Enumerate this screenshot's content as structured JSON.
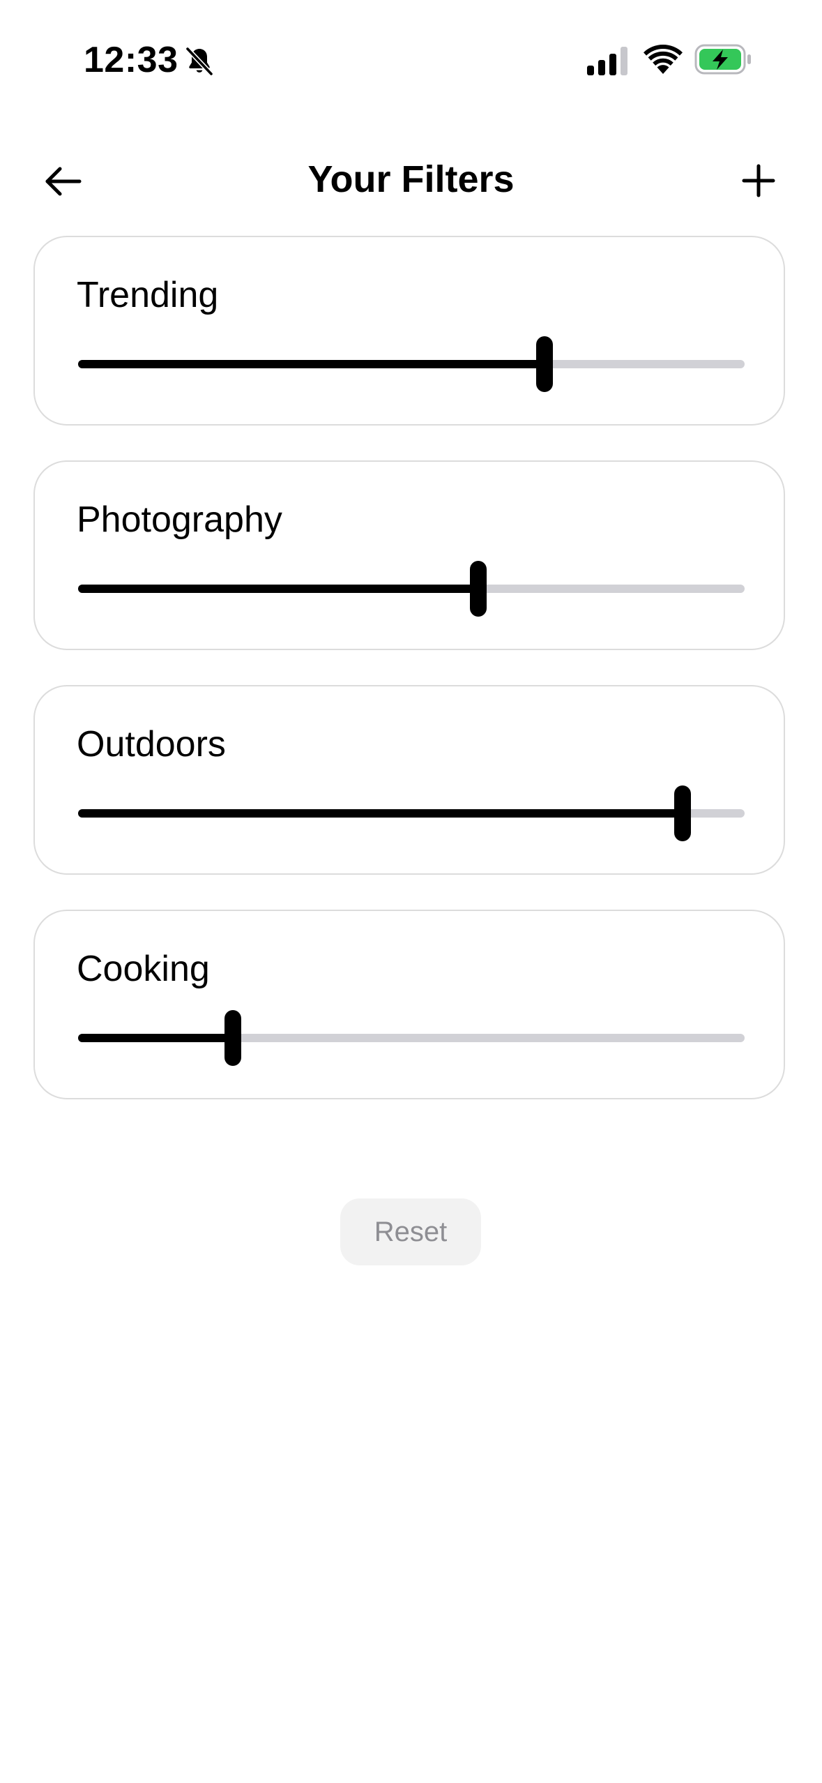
{
  "status_bar": {
    "time": "12:33",
    "icons": [
      "bell-slash-icon",
      "cellular-signal-icon",
      "wifi-icon",
      "battery-charging-icon"
    ],
    "battery_color": "#34c759"
  },
  "nav": {
    "title": "Your Filters",
    "back_icon": "arrow-left-icon",
    "add_icon": "plus-icon"
  },
  "filters": [
    {
      "label": "Trending",
      "value": 0.7
    },
    {
      "label": "Photography",
      "value": 0.6
    },
    {
      "label": "Outdoors",
      "value": 0.907
    },
    {
      "label": "Cooking",
      "value": 0.232
    }
  ],
  "reset": {
    "label": "Reset"
  },
  "colors": {
    "accent": "#000000",
    "track": "#d1d1d6",
    "card_border": "#dcdcdc",
    "reset_bg": "#f2f2f2",
    "reset_text": "#8e8e93"
  }
}
